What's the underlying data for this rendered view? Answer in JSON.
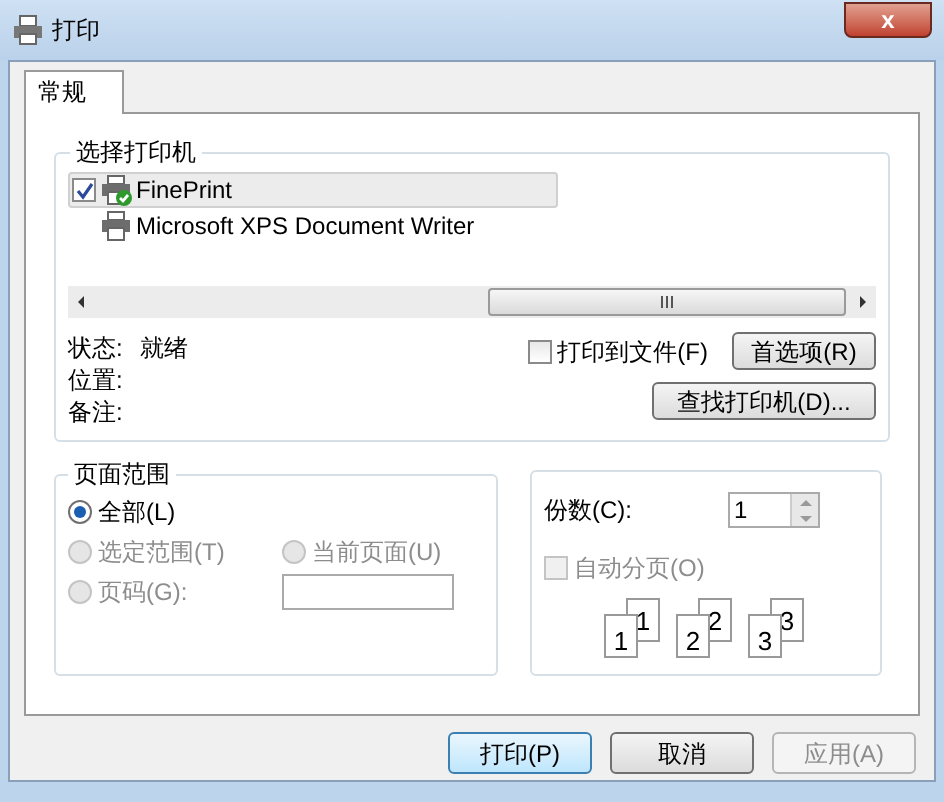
{
  "window": {
    "title": "打印",
    "close": "x"
  },
  "tabs": [
    {
      "label": "常规",
      "selected": true
    }
  ],
  "printer_group": {
    "title": "选择打印机",
    "printers": [
      {
        "name": "FinePrint",
        "checked": true,
        "selected": true,
        "default": true
      },
      {
        "name": "Microsoft XPS Document Writer",
        "checked": false,
        "selected": false,
        "default": false
      }
    ],
    "status": [
      {
        "label": "状态:",
        "value": "就绪"
      },
      {
        "label": "位置:"
      },
      {
        "label": "备注:"
      }
    ],
    "print_to_file": {
      "label": "打印到文件(F)",
      "checked": false
    },
    "preferences_button": "首选项(R)",
    "find_printer_button": "查找打印机(D)..."
  },
  "page_range": {
    "title": "页面范围",
    "options": [
      {
        "label": "全部(L)",
        "selected": true,
        "disabled": false
      },
      {
        "label": "选定范围(T)",
        "selected": false,
        "disabled": true
      },
      {
        "label": "当前页面(U)",
        "selected": false,
        "disabled": true
      },
      {
        "label": "页码(G):",
        "selected": false,
        "disabled": true
      }
    ]
  },
  "copies": {
    "label": "份数(C):",
    "value": "1",
    "collate": {
      "label": "自动分页(O)",
      "checked": false,
      "disabled": true
    },
    "collate_pages": [
      {
        "back": "1",
        "front": "1"
      },
      {
        "back": "2",
        "front": "2"
      },
      {
        "back": "3",
        "front": "3"
      }
    ]
  },
  "buttons": [
    {
      "label": "打印(P)",
      "default": true,
      "disabled": false
    },
    {
      "label": "取消",
      "default": false,
      "disabled": false
    },
    {
      "label": "应用(A)",
      "default": false,
      "disabled": true
    }
  ]
}
